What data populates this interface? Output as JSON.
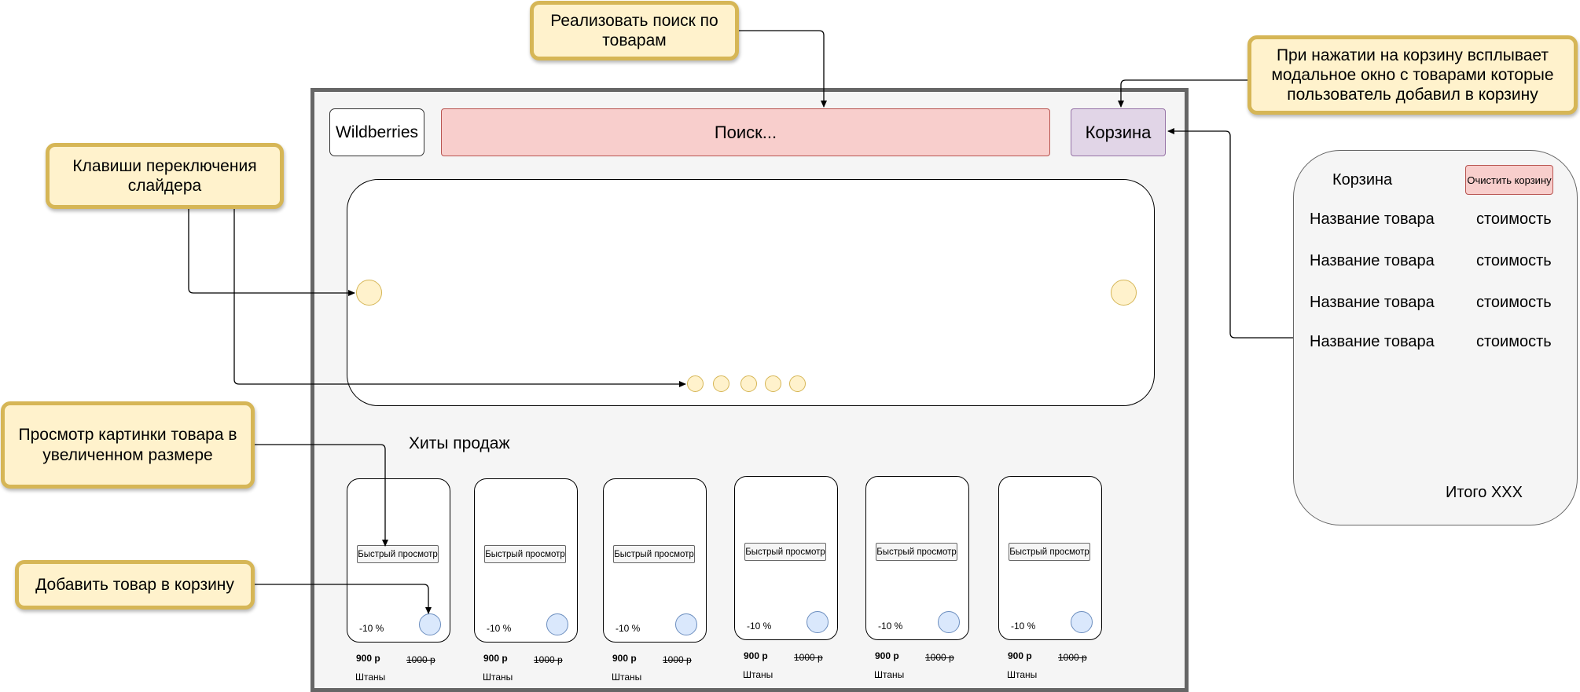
{
  "callouts": {
    "search": "Реализовать поиск по товарам",
    "cart_modal": "При нажатии на корзину всплывает модальное окно с товарами которые пользователь добавил в корзину",
    "slider_keys": "Клавиши переключения слайдера",
    "zoom": "Просмотр картинки товара в увеличенном размере",
    "add_to_cart": "Добавить товар в корзину"
  },
  "header": {
    "logo": "Wildberries",
    "search_placeholder": "Поиск...",
    "cart": "Корзина"
  },
  "hits": {
    "title": "Хиты продаж",
    "products": [
      {
        "quick_view": "Быстрый просмотр",
        "discount": "-10 %",
        "price": "900 р",
        "old_price": "1000 р",
        "name": "Штаны"
      },
      {
        "quick_view": "Быстрый просмотр",
        "discount": "-10 %",
        "price": "900 р",
        "old_price": "1000 р",
        "name": "Штаны"
      },
      {
        "quick_view": "Быстрый просмотр",
        "discount": "-10 %",
        "price": "900 р",
        "old_price": "1000 р",
        "name": "Штаны"
      },
      {
        "quick_view": "Быстрый просмотр",
        "discount": "-10 %",
        "price": "900 р",
        "old_price": "1000 р",
        "name": "Штаны"
      },
      {
        "quick_view": "Быстрый просмотр",
        "discount": "-10 %",
        "price": "900 р",
        "old_price": "1000 р",
        "name": "Штаны"
      },
      {
        "quick_view": "Быстрый просмотр",
        "discount": "-10 %",
        "price": "900 р",
        "old_price": "1000 р",
        "name": "Штаны"
      }
    ]
  },
  "cart_modal": {
    "title": "Корзина",
    "clear_button": "Очистить корзину",
    "items": [
      {
        "name": "Название товара",
        "cost": "стоимость"
      },
      {
        "name": "Название товара",
        "cost": "стоимость"
      },
      {
        "name": "Название товара",
        "cost": "стоимость"
      },
      {
        "name": "Название товара",
        "cost": "стоимость"
      }
    ],
    "total": "Итого XXX"
  },
  "colors": {
    "callout_fill": "#fff2cc",
    "callout_border": "#d6b656",
    "search_fill": "#f8cecc",
    "cart_fill": "#e1d5e7",
    "add_button_fill": "#dae8fc",
    "frame_fill": "#f5f5f5"
  }
}
